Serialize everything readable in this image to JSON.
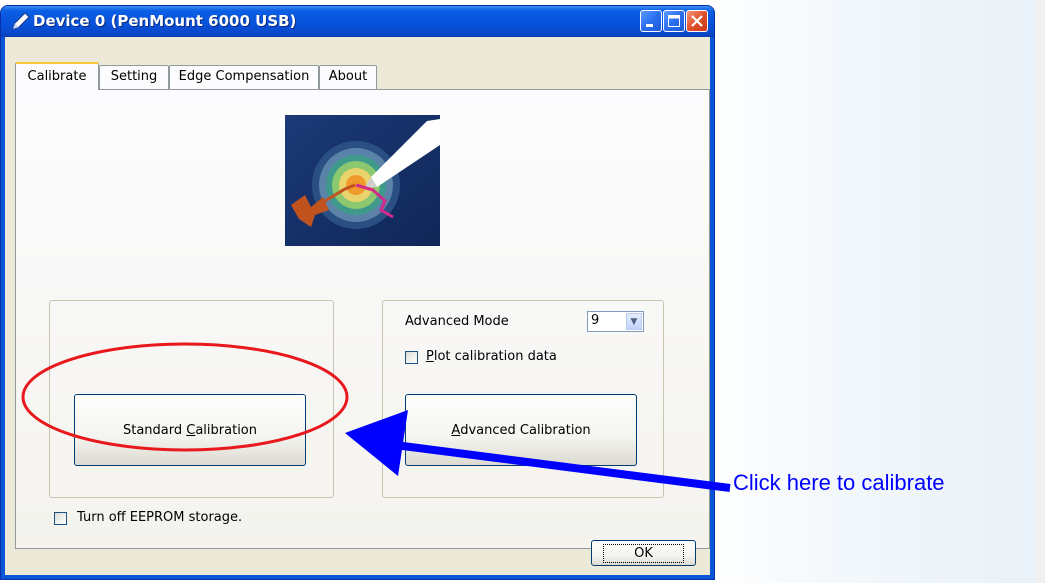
{
  "window": {
    "title": "Device 0 (PenMount 6000 USB)",
    "minimize_icon": "minimize-icon",
    "maximize_icon": "maximize-icon",
    "close_icon": "close-icon"
  },
  "tabs": [
    {
      "label": "Calibrate",
      "active": true
    },
    {
      "label": "Setting",
      "active": false
    },
    {
      "label": "Edge Compensation",
      "active": false
    },
    {
      "label": "About",
      "active": false
    }
  ],
  "calibrate": {
    "standard_button": {
      "prefix": "Standard ",
      "accel": "C",
      "suffix": "alibration"
    },
    "advanced_mode_label": "Advanced Mode",
    "advanced_mode_value": "9",
    "plot_checkbox": {
      "accel": "P",
      "rest": "lot calibration data",
      "checked": false
    },
    "advanced_button": {
      "accel": "A",
      "rest": "dvanced Calibration"
    },
    "eeprom_checkbox": {
      "label": "Turn off EEPROM storage.",
      "checked": false
    }
  },
  "ok_label": "OK",
  "annotation": {
    "text": "Click here to calibrate",
    "color": "#0000ff",
    "circle_color": "#e8181c",
    "arrow_color": "#0000ff"
  },
  "colors": {
    "titlebar": "#0851da",
    "client": "#ece9d8",
    "tab_highlight": "#ffc83c"
  }
}
